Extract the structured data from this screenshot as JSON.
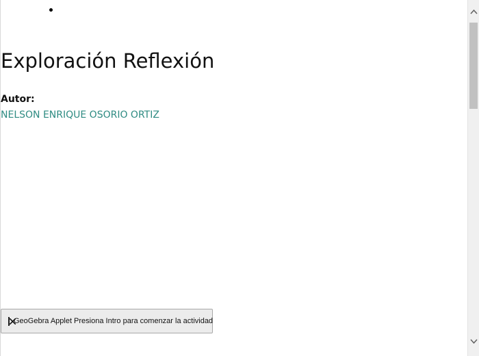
{
  "document": {
    "title": "Exploración Reflexión",
    "author_label": "Autor:",
    "author_name": "NELSON ENRIQUE OSORIO ORTIZ"
  },
  "applet": {
    "label": "GeoGebra Applet Presiona Intro para comenzar la actividad",
    "icon": "broken-image-icon"
  },
  "scrollbar": {
    "up_icon": "chevron-up-icon",
    "down_icon": "chevron-down-icon"
  },
  "colors": {
    "author_link": "#2e8b82",
    "applet_bg": "#ececec",
    "scroll_thumb": "#c1c1c1"
  }
}
